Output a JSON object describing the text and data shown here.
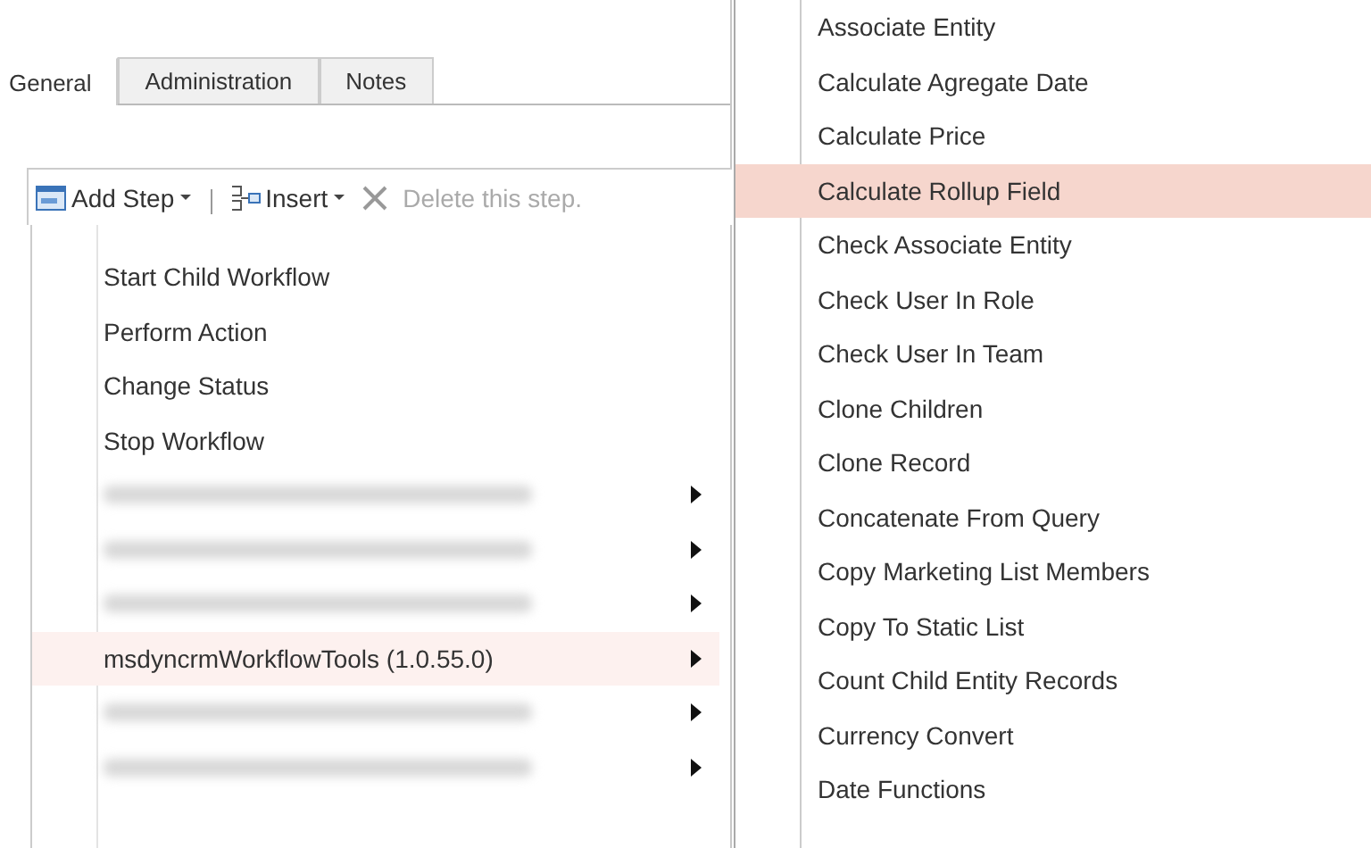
{
  "tabs": [
    {
      "label": "General",
      "selected": true
    },
    {
      "label": "Administration",
      "selected": false
    },
    {
      "label": "Notes",
      "selected": false
    }
  ],
  "toolbar": {
    "add_step": "Add Step",
    "insert": "Insert",
    "delete": {
      "label": "Delete this step.",
      "disabled": true
    }
  },
  "menu": {
    "items": [
      {
        "kind": "item",
        "label": "Start Child Workflow",
        "submenu": false,
        "selected": false
      },
      {
        "kind": "item",
        "label": "Perform Action",
        "submenu": false,
        "selected": false
      },
      {
        "kind": "item",
        "label": "Change Status",
        "submenu": false,
        "selected": false
      },
      {
        "kind": "item",
        "label": "Stop Workflow",
        "submenu": false,
        "selected": false
      },
      {
        "kind": "redacted",
        "submenu": true,
        "selected": false
      },
      {
        "kind": "redacted",
        "submenu": true,
        "selected": false
      },
      {
        "kind": "redacted",
        "submenu": true,
        "selected": false
      },
      {
        "kind": "item",
        "label": "msdyncrmWorkflowTools (1.0.55.0)",
        "submenu": true,
        "selected": true
      },
      {
        "kind": "redacted",
        "submenu": true,
        "selected": false
      },
      {
        "kind": "redacted",
        "submenu": true,
        "selected": false
      }
    ]
  },
  "submenu": {
    "items": [
      {
        "label": "Associate Entity",
        "selected": false
      },
      {
        "label": "Calculate Agregate Date",
        "selected": false
      },
      {
        "label": "Calculate Price",
        "selected": false
      },
      {
        "label": "Calculate Rollup Field",
        "selected": true
      },
      {
        "label": "Check Associate Entity",
        "selected": false
      },
      {
        "label": "Check User In Role",
        "selected": false
      },
      {
        "label": "Check User In Team",
        "selected": false
      },
      {
        "label": "Clone Children",
        "selected": false
      },
      {
        "label": "Clone Record",
        "selected": false
      },
      {
        "label": "Concatenate From Query",
        "selected": false
      },
      {
        "label": "Copy Marketing List Members",
        "selected": false
      },
      {
        "label": "Copy To Static List",
        "selected": false
      },
      {
        "label": "Count Child Entity Records",
        "selected": false
      },
      {
        "label": "Currency Convert",
        "selected": false
      },
      {
        "label": "Date Functions",
        "selected": false
      }
    ]
  }
}
